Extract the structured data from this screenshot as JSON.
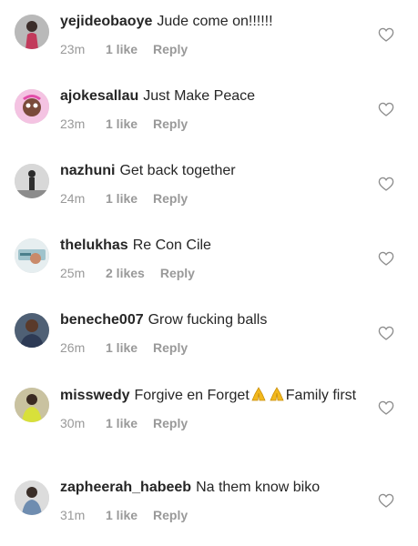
{
  "comments": [
    {
      "username": "yejideobaoye",
      "text": "Jude come on!!!!!!",
      "time": "23m",
      "likes": "1 like",
      "reply": "Reply",
      "avatar_color": "#8f8f8f"
    },
    {
      "username": "ajokesallau",
      "text": "Just Make Peace",
      "time": "23m",
      "likes": "1 like",
      "reply": "Reply",
      "avatar_color": "#e89bd1"
    },
    {
      "username": "nazhuni",
      "text": "Get back together",
      "time": "24m",
      "likes": "1 like",
      "reply": "Reply",
      "avatar_color": "#9a9a9a"
    },
    {
      "username": "thelukhas",
      "text": "Re Con Cile",
      "time": "25m",
      "likes": "2 likes",
      "reply": "Reply",
      "avatar_color": "#c7d9de"
    },
    {
      "username": "beneche007",
      "text": "Grow fucking balls",
      "time": "26m",
      "likes": "1 like",
      "reply": "Reply",
      "avatar_color": "#5d6f86"
    },
    {
      "username": "misswedy",
      "text_before": "Forgive en Forget",
      "emoji": "folded-hands",
      "text_after": "Family first",
      "time": "30m",
      "likes": "1 like",
      "reply": "Reply",
      "avatar_color": "#b3a77a"
    },
    {
      "username": "zapheerah_habeeb",
      "text": "Na them know biko",
      "time": "31m",
      "likes": "1 like",
      "reply": "Reply",
      "avatar_color": "#a8a8a8"
    }
  ],
  "icons": {
    "heart": "heart-outline-icon",
    "emoji": "folded-hands-emoji"
  },
  "colors": {
    "text": "#262626",
    "meta": "#999999",
    "heart_stroke": "#8e8e8e",
    "emoji": "#f2b81d"
  }
}
